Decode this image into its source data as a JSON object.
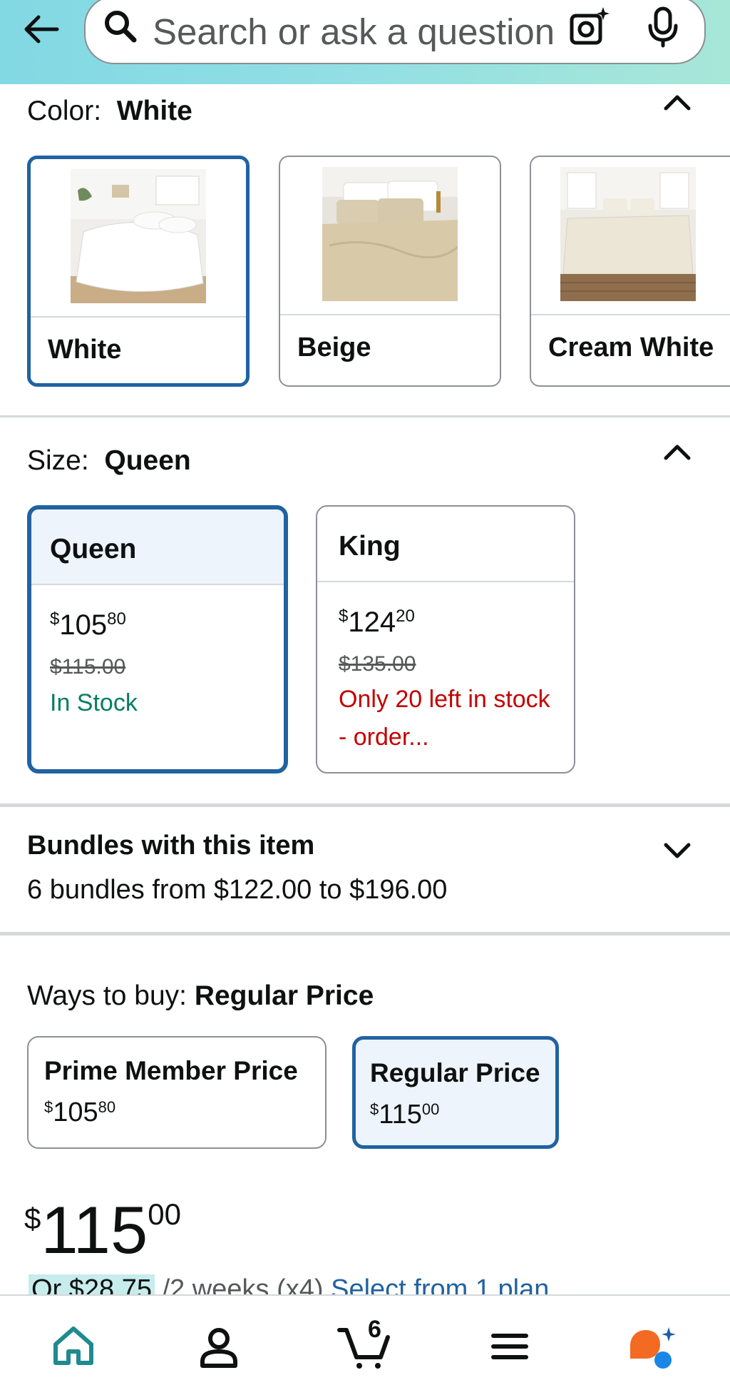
{
  "header": {
    "search_placeholder": "Search or ask a question"
  },
  "color": {
    "label": "Color:",
    "selected": "White",
    "options": [
      {
        "label": "White",
        "selected": true
      },
      {
        "label": "Beige",
        "selected": false
      },
      {
        "label": "Cream White",
        "selected": false
      }
    ]
  },
  "size": {
    "label": "Size:",
    "selected": "Queen",
    "options": [
      {
        "label": "Queen",
        "price_whole": "105",
        "price_fraction": "80",
        "list_price": "$115.00",
        "stock": "In Stock",
        "selected": true
      },
      {
        "label": "King",
        "price_whole": "124",
        "price_fraction": "20",
        "list_price": "$135.00",
        "stock": "Only 20 left in stock - order...",
        "selected": false
      }
    ]
  },
  "bundles": {
    "title": "Bundles with this item",
    "subtitle": "6 bundles from $122.00 to $196.00"
  },
  "ways_to_buy": {
    "label": "Ways to buy:",
    "selected": "Regular Price",
    "options": [
      {
        "label": "Prime Member Price",
        "price_whole": "105",
        "price_fraction": "80",
        "selected": false
      },
      {
        "label": "Regular Price",
        "price_whole": "115",
        "price_fraction": "00",
        "selected": true
      }
    ]
  },
  "price": {
    "currency": "$",
    "whole": "115",
    "fraction": "00"
  },
  "installment": {
    "amount": "Or $28.75",
    "term": "/2 weeks (x4)",
    "link": "Select from 1 plan"
  },
  "bottom_nav": {
    "cart_count": "6"
  },
  "colors": {
    "selected_border": "#2162a1",
    "selected_fill": "#edf4fc",
    "in_stock": "#067d62",
    "low_stock": "#c40000",
    "home_icon": "#1f8a8f"
  }
}
